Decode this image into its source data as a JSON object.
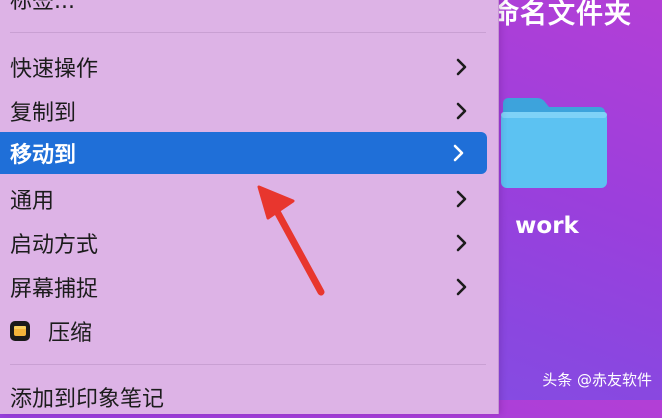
{
  "desktop": {
    "folder_title": "命名文件夹",
    "folder_label": "work",
    "watermark": "头条 @赤友软件"
  },
  "menu": {
    "top_cut_label": "标签...",
    "items": [
      {
        "label": "快速操作",
        "submenu": true
      },
      {
        "label": "复制到",
        "submenu": true
      },
      {
        "label": "移动到",
        "submenu": true,
        "selected": true
      },
      {
        "label": "通用",
        "submenu": true
      },
      {
        "label": "启动方式",
        "submenu": true
      },
      {
        "label": "屏幕捕捉",
        "submenu": true
      },
      {
        "label": "压缩",
        "submenu": false,
        "icon": "archive-app-icon"
      }
    ],
    "bottom_cut_label": "添加到印象笔记"
  },
  "colors": {
    "menu_bg": "#ddb3e6",
    "selected_bg": "#1f6fd8",
    "arrow": "#e8362e",
    "folder": "#5cc2f2"
  }
}
